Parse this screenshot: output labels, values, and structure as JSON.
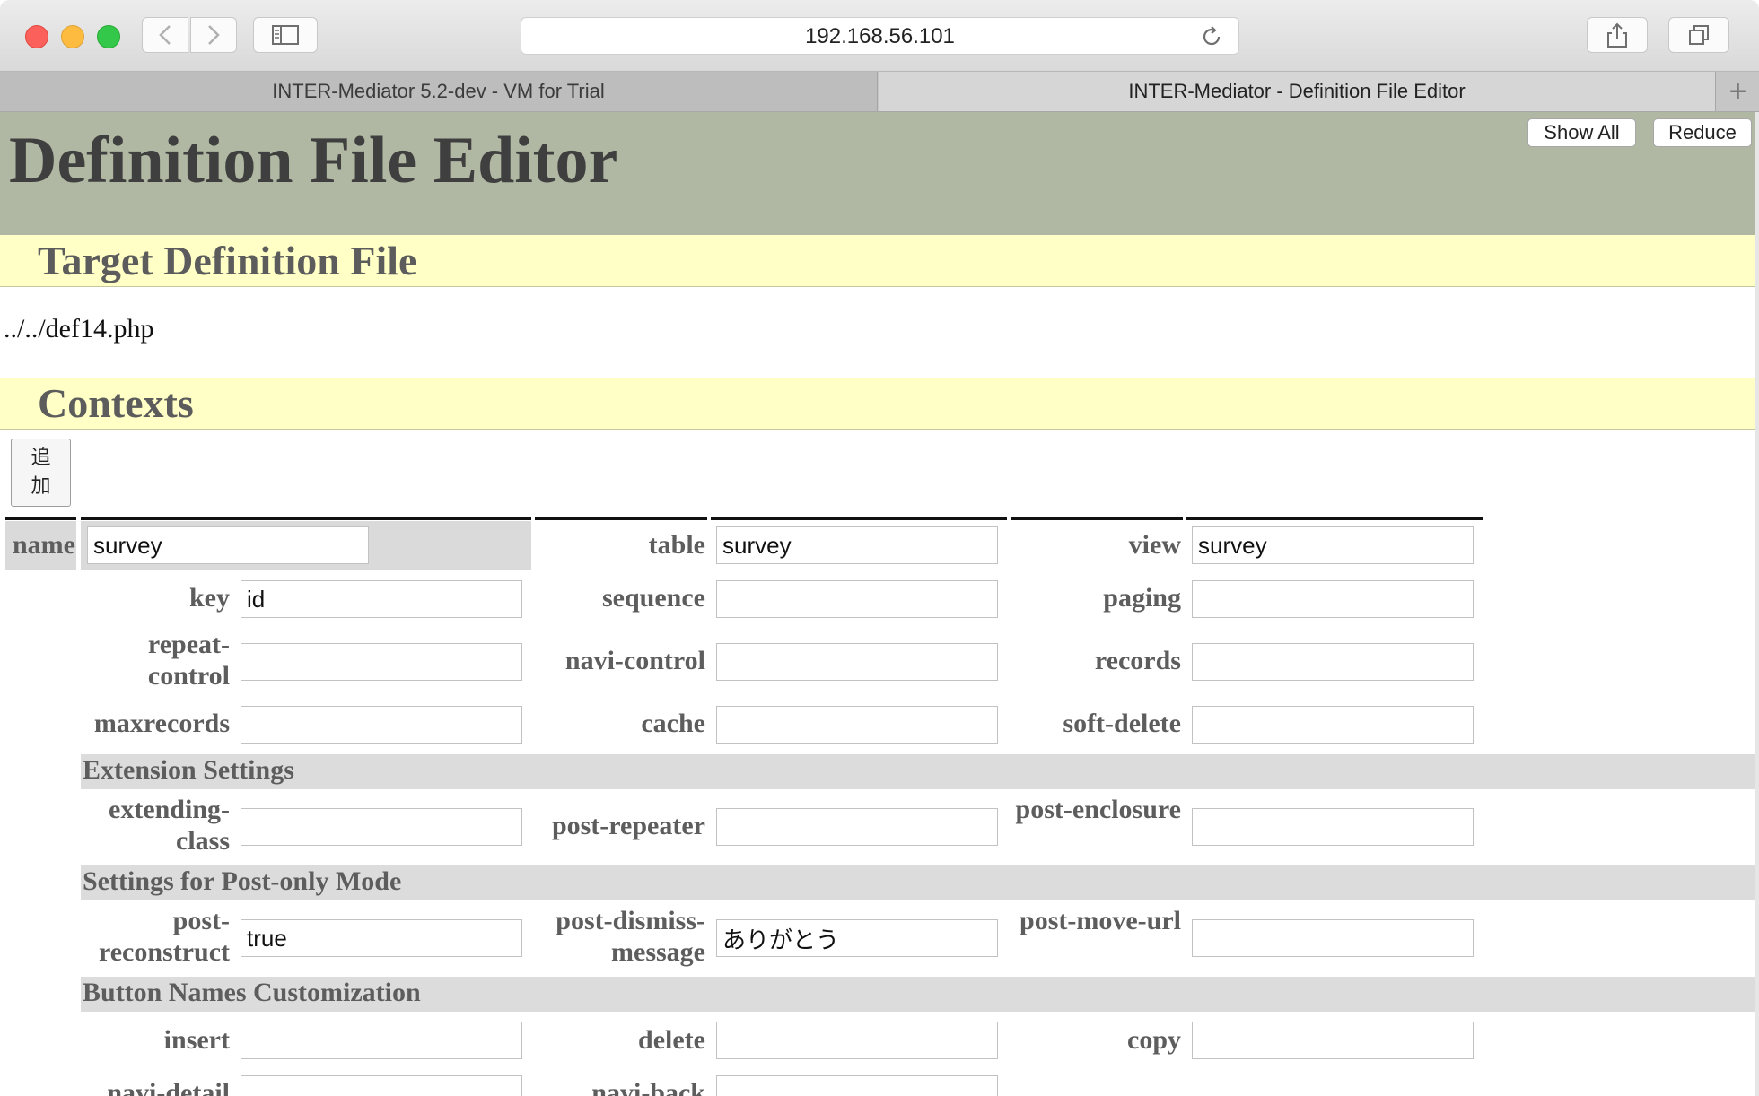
{
  "browser": {
    "url": "192.168.56.101",
    "tabs": [
      {
        "label": "INTER-Mediator 5.2-dev - VM for Trial"
      },
      {
        "label": "INTER-Mediator - Definition File Editor"
      }
    ],
    "new_tab": "+"
  },
  "page": {
    "title": "Definition File Editor",
    "show_all": "Show All",
    "reduce": "Reduce",
    "target_heading": "Target Definition File",
    "target_file": "../../def14.php",
    "contexts_heading": "Contexts",
    "add_button": "追加"
  },
  "context": {
    "name": {
      "label": "name",
      "value": "survey"
    },
    "table": {
      "label": "table",
      "value": "survey"
    },
    "view": {
      "label": "view",
      "value": "survey"
    },
    "key": {
      "label": "key",
      "value": "id"
    },
    "sequence": {
      "label": "sequence",
      "value": ""
    },
    "paging": {
      "label": "paging",
      "value": ""
    },
    "repeat_control": {
      "label": "repeat-control",
      "value": ""
    },
    "navi_control": {
      "label": "navi-control",
      "value": ""
    },
    "records": {
      "label": "records",
      "value": ""
    },
    "maxrecords": {
      "label": "maxrecords",
      "value": ""
    },
    "cache": {
      "label": "cache",
      "value": ""
    },
    "soft_delete": {
      "label": "soft-delete",
      "value": ""
    },
    "extension_heading": "Extension Settings",
    "extending_class": {
      "label": "extending-class",
      "value": ""
    },
    "post_repeater": {
      "label": "post-repeater",
      "value": ""
    },
    "post_enclosure": {
      "label": "post-enclosure",
      "value": ""
    },
    "postonly_heading": "Settings for Post-only Mode",
    "post_reconstruct": {
      "label": "post-reconstruct",
      "value": "true"
    },
    "post_dismiss_message": {
      "label": "post-dismiss-message",
      "value": "ありがとう"
    },
    "post_move_url": {
      "label": "post-move-url",
      "value": ""
    },
    "buttons_heading": "Button Names Customization",
    "insert": {
      "label": "insert",
      "value": ""
    },
    "delete": {
      "label": "delete",
      "value": ""
    },
    "copy": {
      "label": "copy",
      "value": ""
    },
    "navi_detail": {
      "label": "navi-detail",
      "value": ""
    },
    "navi_back": {
      "label": "navi-back",
      "value": ""
    }
  }
}
